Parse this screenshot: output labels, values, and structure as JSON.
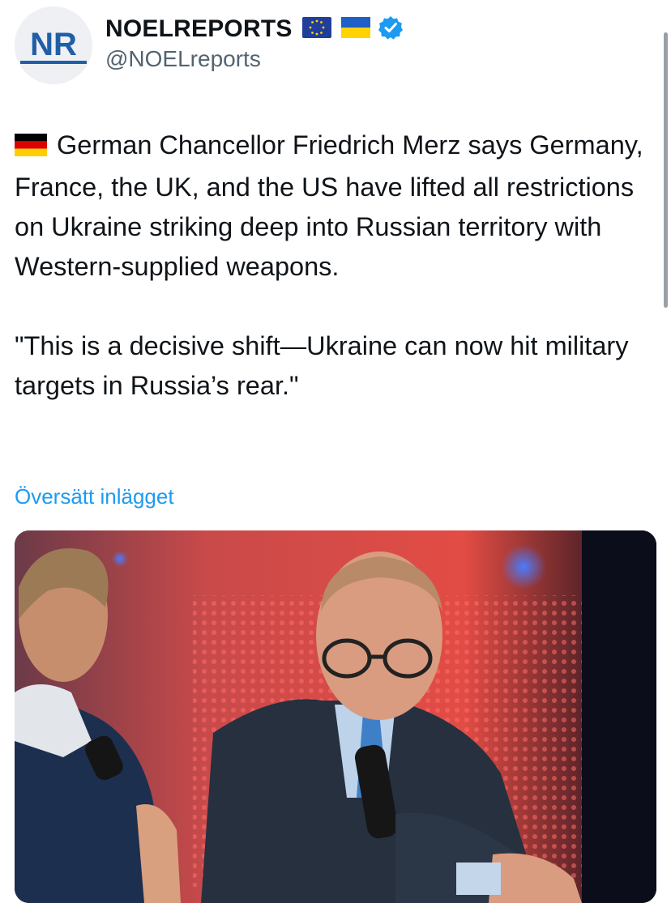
{
  "account": {
    "display_name": "NOELREPORTS",
    "handle": "@NOELreports",
    "avatar_logo": "NR",
    "name_badges": [
      "eu-flag-icon",
      "ukraine-flag-icon",
      "verified-badge-icon"
    ],
    "verified_color": "#1d9bf0"
  },
  "tweet": {
    "flag_icon": "germany-flag-icon",
    "paragraph1": "German Chancellor Friedrich Merz says Germany, France, the UK, and the US have lifted all restrictions on Ukraine striking deep into Russian territory with Western-supplied weapons.",
    "paragraph2": "\"This is a decisive shift—Ukraine can now hit military targets in Russia’s rear.\"",
    "translate_link": "Översätt inlägget"
  },
  "colors": {
    "text": "#0f1419",
    "secondary": "#536471",
    "link": "#1d9bf0",
    "brand_blue": "#1f5fa8"
  },
  "media": {
    "icon": "photo-image",
    "subject": "photo of a man in glasses and dark suit holding a microphone, seated, red studio background"
  }
}
